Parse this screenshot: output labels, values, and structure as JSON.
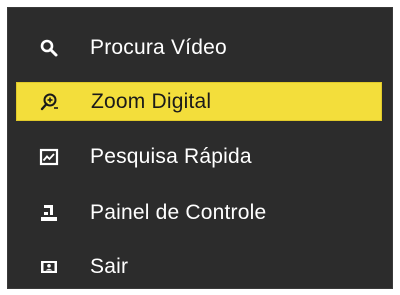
{
  "menu": {
    "items": [
      {
        "label": "Procura Vídeo",
        "icon": "search-icon",
        "selected": false
      },
      {
        "label": "Zoom Digital",
        "icon": "zoom-in-icon",
        "selected": true
      },
      {
        "label": "Pesquisa Rápida",
        "icon": "image-chart-icon",
        "selected": false
      },
      {
        "label": "Painel de Controle",
        "icon": "control-panel-icon",
        "selected": false
      },
      {
        "label": "Sair",
        "icon": "exit-icon",
        "selected": false
      }
    ]
  },
  "colors": {
    "menu_background": "#2c2c2c",
    "highlight": "#f3de3b",
    "text": "#ffffff",
    "highlight_text": "#1a1a1a"
  }
}
